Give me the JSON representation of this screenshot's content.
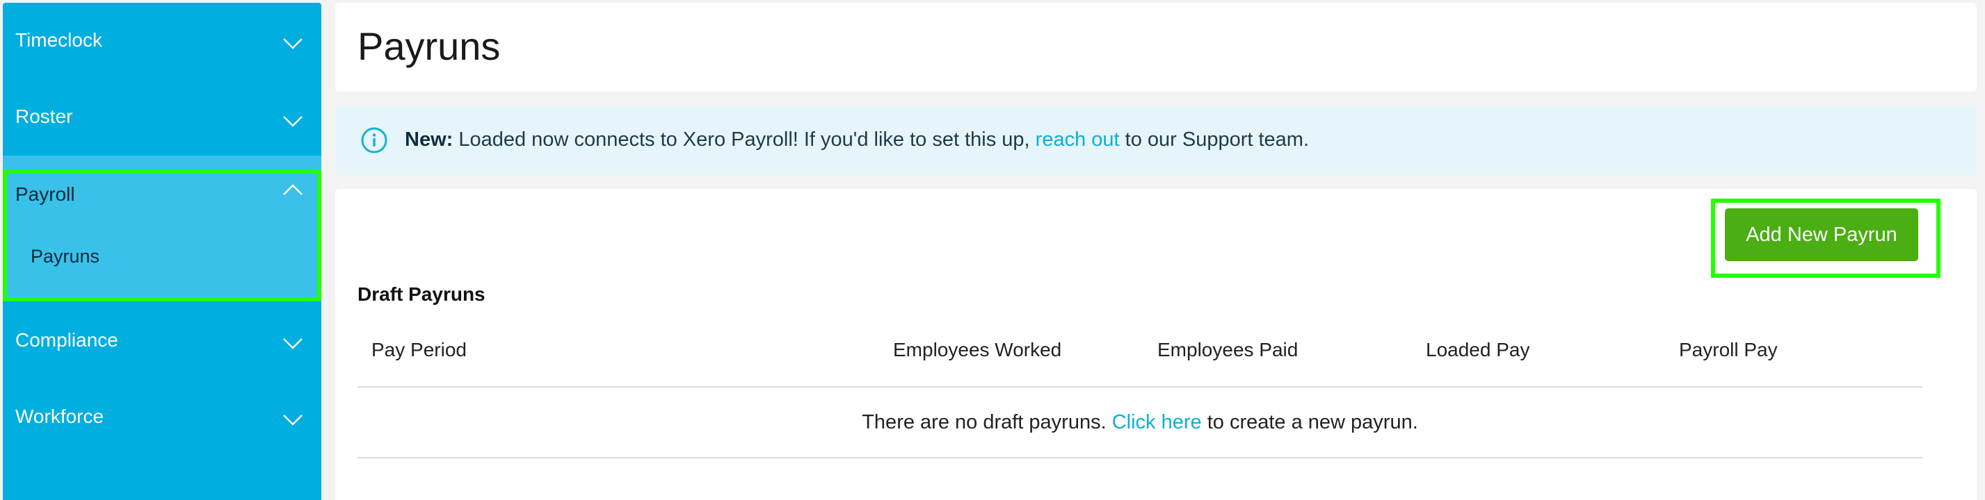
{
  "sidebar": {
    "items": [
      {
        "label": "Timeclock",
        "icon": "chevron-down-icon"
      },
      {
        "label": "Roster",
        "icon": "chevron-down-icon"
      },
      {
        "label": "Payroll",
        "icon": "chevron-up-icon",
        "sub_items": [
          {
            "label": "Payruns"
          }
        ]
      },
      {
        "label": "Compliance",
        "icon": "chevron-down-icon"
      },
      {
        "label": "Workforce",
        "icon": "chevron-down-icon"
      }
    ],
    "background_color": "#00aee0",
    "active_group_color": "#39c1e9"
  },
  "header": {
    "title": "Payruns"
  },
  "banner": {
    "icon": "info-icon",
    "new_label": "New:",
    "text_before_link": " Loaded now connects to Xero Payroll! If you'd like to set this up, ",
    "link_text": "reach out",
    "text_after_link": " to our Support team."
  },
  "toolbar": {
    "add_button_label": "Add New Payrun",
    "add_button_color": "#4bae12"
  },
  "drafts": {
    "section_title": "Draft Payruns",
    "columns": [
      "Pay Period",
      "Employees Worked",
      "Employees Paid",
      "Loaded Pay",
      "Payroll Pay"
    ],
    "empty_text_before": "There are no draft payruns. ",
    "empty_link": "Click here",
    "empty_text_after": " to create a new payrun."
  },
  "colors": {
    "link": "#0bb0d6",
    "highlight": "#22ff00"
  }
}
